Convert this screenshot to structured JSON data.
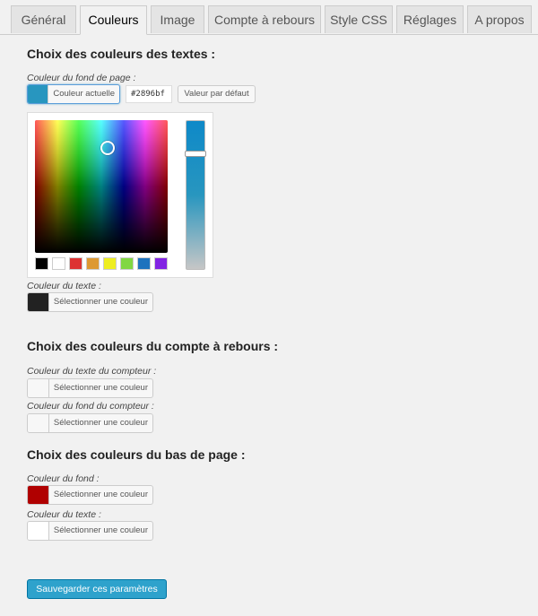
{
  "tabs": [
    {
      "label": "Général"
    },
    {
      "label": "Couleurs",
      "active": true
    },
    {
      "label": "Image"
    },
    {
      "label": "Compte à rebours"
    },
    {
      "label": "Style CSS"
    },
    {
      "label": "Réglages"
    },
    {
      "label": "A propos"
    }
  ],
  "sections": {
    "texts": {
      "title": "Choix des couleurs des textes :",
      "page_bg": {
        "label": "Couleur du fond de page :",
        "button": "Couleur actuelle",
        "color": "#2896bf",
        "hex_value": "#2896bf",
        "default_button": "Valeur par défaut"
      },
      "text_color": {
        "label": "Couleur du texte :",
        "button": "Sélectionner une couleur",
        "color": "#222222"
      }
    },
    "countdown": {
      "title": "Choix des couleurs du compte à rebours :",
      "counter_text": {
        "label": "Couleur du texte du compteur :",
        "button": "Sélectionner une couleur",
        "color": "#f7f7f7"
      },
      "counter_bg": {
        "label": "Couleur du fond du compteur :",
        "button": "Sélectionner une couleur",
        "color": "#f7f7f7"
      }
    },
    "footer": {
      "title": "Choix des couleurs du bas de page :",
      "bg": {
        "label": "Couleur du fond :",
        "button": "Sélectionner une couleur",
        "color": "#b00000"
      },
      "text": {
        "label": "Couleur du texte :",
        "button": "Sélectionner une couleur",
        "color": "#ffffff"
      }
    }
  },
  "palette": [
    "#000000",
    "#ffffff",
    "#dd3333",
    "#dd9933",
    "#eeee22",
    "#81d742",
    "#1e73be",
    "#8224e3"
  ],
  "save_button": "Sauvegarder ces paramètres"
}
